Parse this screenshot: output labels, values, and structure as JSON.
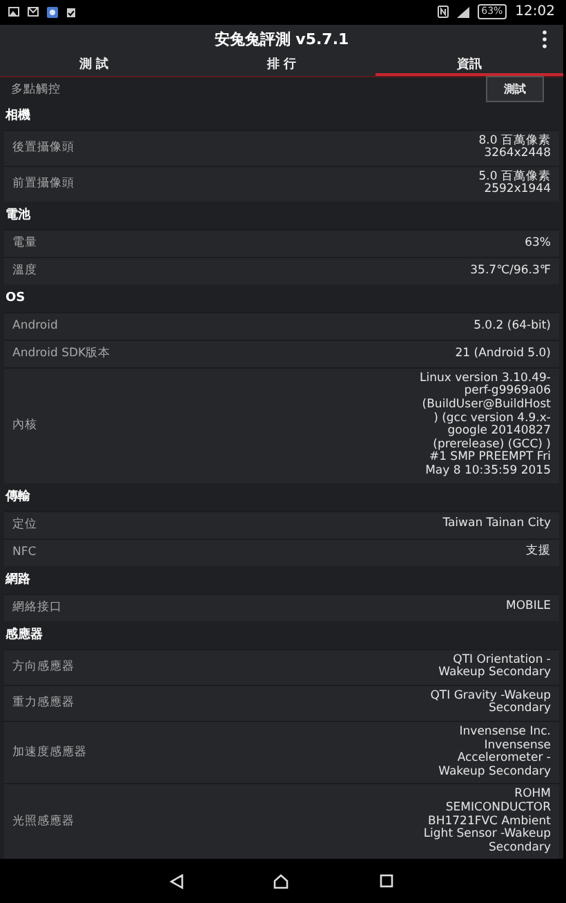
{
  "status_bar": {
    "battery": "63%",
    "time": "12:02"
  },
  "app_bar": {
    "title": "安兔兔評測 v5.7.1"
  },
  "tabs": [
    {
      "label": "測 試",
      "selected": false
    },
    {
      "label": "排 行",
      "selected": false
    },
    {
      "label": "資訊",
      "selected": true
    }
  ],
  "items": [
    {
      "kind": "button_row",
      "label": "多點觸控",
      "button": "測試"
    },
    {
      "kind": "header",
      "label": "相機"
    },
    {
      "kind": "row",
      "label": "後置攝像頭",
      "value": [
        "8.0 百萬像素",
        "3264x2448"
      ]
    },
    {
      "kind": "row",
      "label": "前置攝像頭",
      "value": [
        "5.0 百萬像素",
        "2592x1944"
      ]
    },
    {
      "kind": "header",
      "label": "電池"
    },
    {
      "kind": "row",
      "label": "電量",
      "value": [
        "63%"
      ]
    },
    {
      "kind": "row",
      "label": "溫度",
      "value": [
        "35.7℃/96.3℉"
      ]
    },
    {
      "kind": "header",
      "label": "OS"
    },
    {
      "kind": "row",
      "label": "Android",
      "value": [
        "5.0.2 (64-bit)"
      ]
    },
    {
      "kind": "row",
      "label": "Android SDK版本",
      "value": [
        "21  (Android 5.0)"
      ]
    },
    {
      "kind": "row",
      "label": "內核",
      "value": [
        "Linux version 3.10.49-",
        "perf-g9969a06",
        "(BuildUser@BuildHost",
        ") (gcc version 4.9.x-",
        "google 20140827",
        "(prerelease) (GCC) )",
        "#1 SMP PREEMPT Fri",
        "May 8 10:35:59 2015"
      ]
    },
    {
      "kind": "header",
      "label": "傳輸"
    },
    {
      "kind": "row",
      "label": "定位",
      "value": [
        "Taiwan Tainan City"
      ]
    },
    {
      "kind": "row",
      "label": "NFC",
      "value": [
        "支援"
      ]
    },
    {
      "kind": "header",
      "label": "網路"
    },
    {
      "kind": "row",
      "label": "網絡接口",
      "value": [
        "MOBILE"
      ]
    },
    {
      "kind": "header",
      "label": "感應器"
    },
    {
      "kind": "row",
      "label": "方向感應器",
      "value": [
        "QTI Orientation -",
        "Wakeup Secondary"
      ]
    },
    {
      "kind": "row",
      "label": "重力感應器",
      "value": [
        "QTI Gravity -Wakeup",
        "Secondary"
      ]
    },
    {
      "kind": "row",
      "label": "加速度感應器",
      "value": [
        "Invensense Inc.",
        "Invensense",
        "Accelerometer -",
        "Wakeup Secondary"
      ]
    },
    {
      "kind": "row",
      "label": "光照感應器",
      "value": [
        "ROHM",
        "SEMICONDUCTOR",
        "BH1721FVC Ambient",
        "Light Sensor -Wakeup",
        "Secondary"
      ]
    }
  ]
}
